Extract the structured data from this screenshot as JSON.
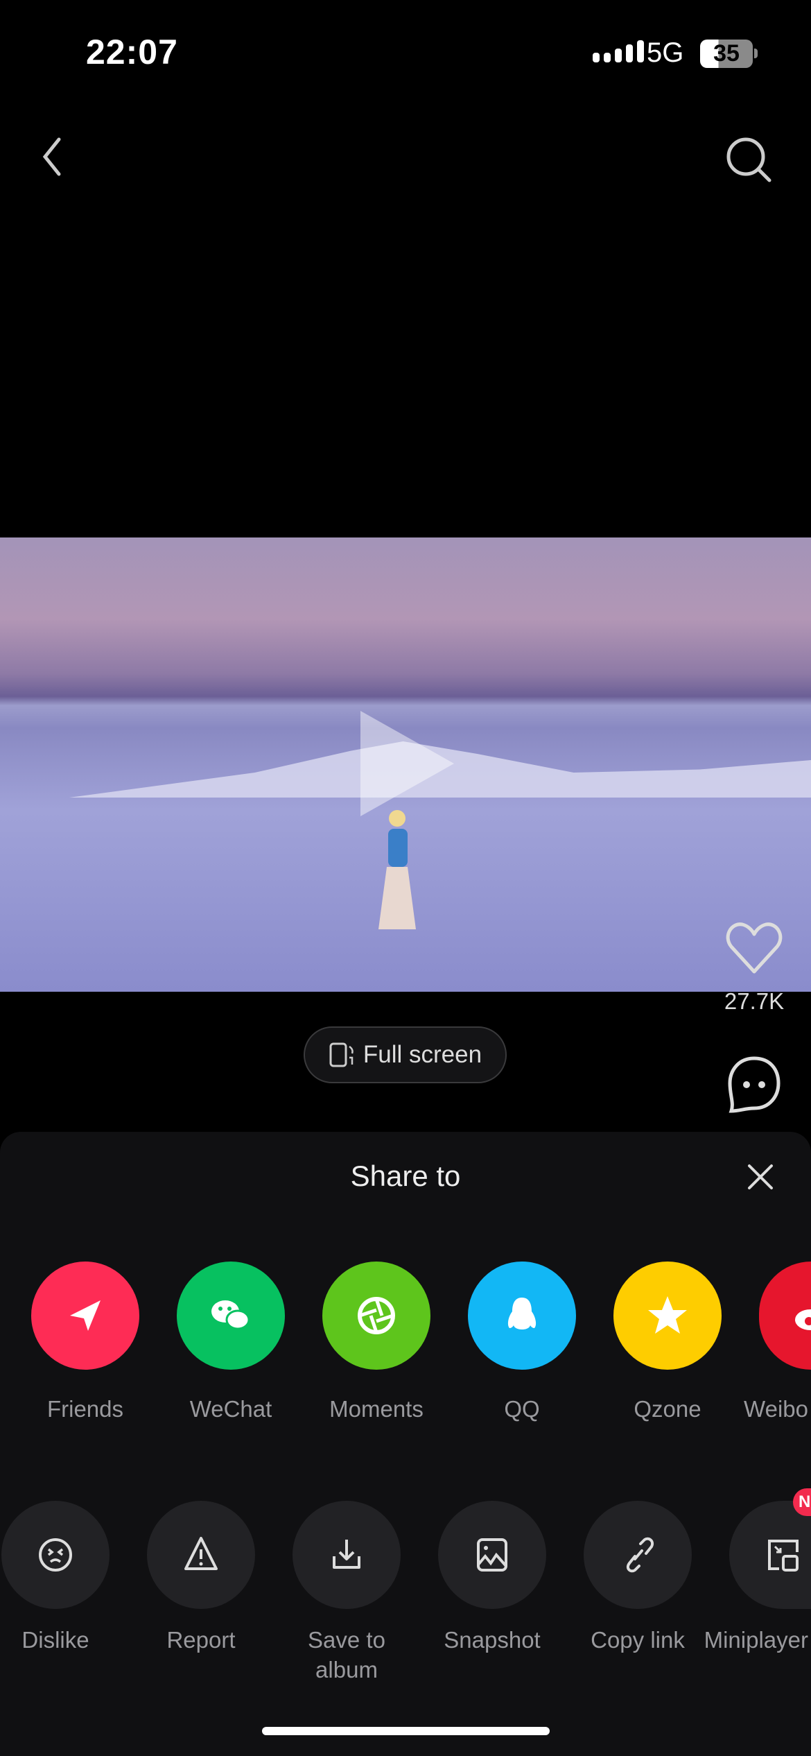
{
  "status_bar": {
    "time": "22:07",
    "network": "5G",
    "battery": "35",
    "battery_level_percent": 35
  },
  "video": {
    "likes": "27.7K",
    "full_screen_label": "Full screen"
  },
  "share_sheet": {
    "title": "Share to",
    "targets": [
      {
        "label": "Friends",
        "color": "#fe2c55",
        "icon": "paper-plane-icon"
      },
      {
        "label": "WeChat",
        "color": "#07c160",
        "icon": "wechat-icon"
      },
      {
        "label": "Moments",
        "color": "#5ec51c",
        "icon": "aperture-icon"
      },
      {
        "label": "QQ",
        "color": "#12b7f5",
        "icon": "penguin-icon"
      },
      {
        "label": "Qzone",
        "color": "#fecd00",
        "icon": "star-icon"
      },
      {
        "label": "Weibo",
        "color": "#e6162d",
        "icon": "weibo-icon"
      }
    ],
    "actions": [
      {
        "label": "Dislike",
        "icon": "dislike-face-icon"
      },
      {
        "label": "Report",
        "icon": "warning-icon"
      },
      {
        "label": "Save to album",
        "icon": "download-icon"
      },
      {
        "label": "Snapshot",
        "icon": "image-icon"
      },
      {
        "label": "Copy link",
        "icon": "link-icon"
      },
      {
        "label": "Miniplayer",
        "icon": "miniplayer-icon",
        "badge": "N"
      }
    ]
  }
}
